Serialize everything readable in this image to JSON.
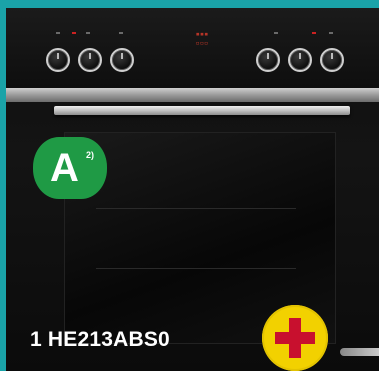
{
  "energy_label": {
    "letter": "A",
    "superscript": "2)"
  },
  "product": {
    "model": "1 HE213ABS0"
  },
  "colors": {
    "background": "#1aa3a8",
    "badge_green": "#1f9a45",
    "plus_yellow": "#f2d100",
    "plus_red": "#c8102e"
  },
  "icons": [
    "plus-icon"
  ]
}
